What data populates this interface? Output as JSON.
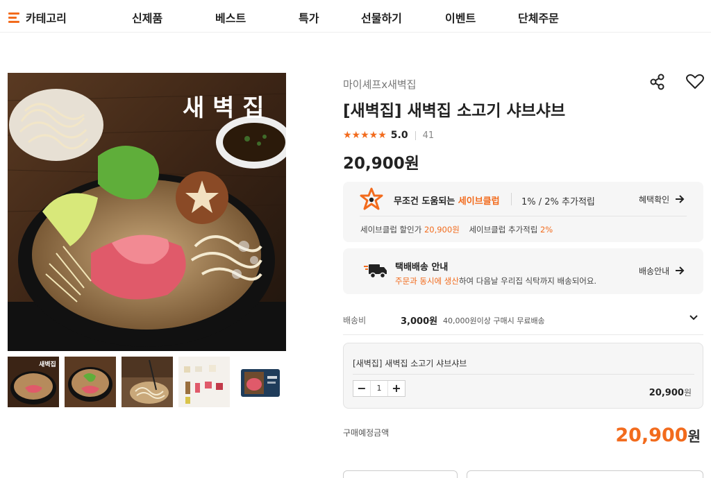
{
  "nav": {
    "category_label": "카테고리",
    "items": [
      "신제품",
      "베스트",
      "특가",
      "선물하기",
      "이벤트",
      "단체주문"
    ]
  },
  "product": {
    "brand": "마이셰프x새벽집",
    "title": "[새벽집] 새벽집 소고기 샤브샤브",
    "image_text": "새 벽 집",
    "rating_stars": "★★★★★",
    "rating_score": "5.0",
    "review_count": "41",
    "price": "20,900원"
  },
  "save_club": {
    "title_prefix": "무조건 도움되는 ",
    "title_highlight": "세이브클럽",
    "rate_text": "1% / 2% 추가적립",
    "benefit_button": "혜택확인",
    "discount_label": "세이브클럽 할인가 ",
    "discount_price": "20,900원",
    "extra_label": "세이브클럽 추가적립 ",
    "extra_rate": "2%"
  },
  "delivery": {
    "title": "택배배송 안내",
    "desc_highlight": "주문과 동시에 생산",
    "desc_rest": "하여 다음날 우리집 식탁까지 배송되어요.",
    "button": "배송안내"
  },
  "shipping_fee": {
    "label": "배송비",
    "value": "3,000원",
    "note": "40,000원이상 구매시 무료배송"
  },
  "option": {
    "name": "[새벽집] 새벽집 소고기 샤브샤브",
    "quantity": "1",
    "minus": "−",
    "plus": "+",
    "price_num": "20,900",
    "price_unit": "원"
  },
  "total": {
    "label": "구매예정금액",
    "amount": "20,900",
    "unit": "원"
  },
  "colors": {
    "accent": "#f26b1d",
    "panel_bg": "#f6f6f6"
  }
}
